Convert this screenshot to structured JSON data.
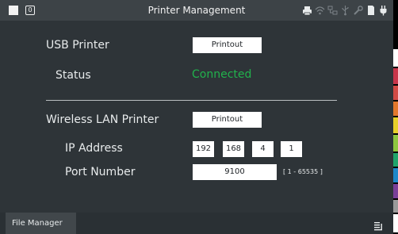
{
  "header": {
    "title": "Printer Management",
    "badge": "0",
    "icons": [
      "printer-icon",
      "wifi-icon",
      "lan-icon",
      "usb-icon",
      "wrench-icon",
      "sd-card-icon",
      "power-plug-icon"
    ]
  },
  "usb_printer": {
    "label": "USB Printer",
    "button_label": "Printout",
    "status_label": "Status",
    "status_value": "Connected",
    "status_color": "#21b24c"
  },
  "wireless_printer": {
    "label": "Wireless LAN Printer",
    "button_label": "Printout",
    "ip_label": "IP Address",
    "ip_octets": [
      "192",
      "168",
      "4",
      "1"
    ],
    "port_label": "Port Number",
    "port_value": "9100",
    "port_range": "[ 1 - 65535 ]"
  },
  "footer": {
    "tab_label": "File Manager",
    "menu_icon": "list-menu-icon"
  },
  "colors": {
    "background": "#2e3438",
    "titlebar": "#3d4347",
    "side_strip": [
      "#000000",
      "#ffffff",
      "#c8354a",
      "#d24a45",
      "#e3782c",
      "#e7d02b",
      "#8ec63f",
      "#1fa46b",
      "#1e88c9",
      "#7a3f98",
      "#9a9a9a",
      "#ffffff"
    ]
  }
}
